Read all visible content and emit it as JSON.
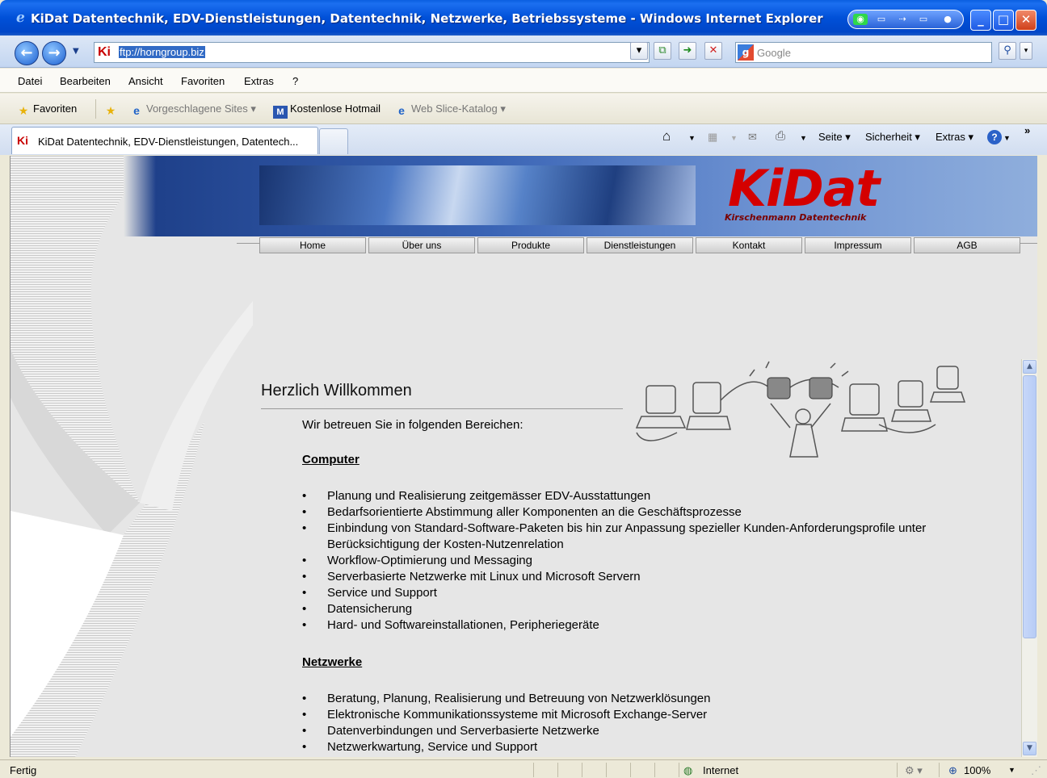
{
  "window": {
    "title": "KiDat Datentechnik, EDV-Dienstleistungen, Datentechnik, Netzwerke, Betriebssysteme - Windows Internet Explorer"
  },
  "address_bar": {
    "favicon_text": "Ki",
    "url": "ftp://horngroup.biz"
  },
  "search": {
    "placeholder": "Google",
    "engine_icon": "google-icon"
  },
  "menu": [
    "Datei",
    "Bearbeiten",
    "Ansicht",
    "Favoriten",
    "Extras",
    "?"
  ],
  "favorites_bar": {
    "favorites_label": "Favoriten",
    "items": [
      {
        "label": "Vorgeschlagene Sites ▾",
        "icon": "ie-icon"
      },
      {
        "label": "Kostenlose Hotmail",
        "icon": "hotmail-icon"
      },
      {
        "label": "Web Slice-Katalog ▾",
        "icon": "webslice-icon"
      }
    ]
  },
  "tab": {
    "favicon_text": "Ki",
    "title": "KiDat Datentechnik, EDV-Dienstleistungen, Datentech..."
  },
  "command_bar": {
    "seite": "Seite ▾",
    "sicherheit": "Sicherheit ▾",
    "extras": "Extras ▾",
    "more": "»"
  },
  "site": {
    "logo_text": "KiDat",
    "logo_tagline": "Kirschenmann Datentechnik",
    "nav": [
      "Home",
      "Über uns",
      "Produkte",
      "Dienstleistungen",
      "Kontakt",
      "Impressum",
      "AGB"
    ],
    "heading": "Herzlich Willkommen",
    "intro": "Wir betreuen Sie in folgenden Bereichen:",
    "sections": [
      {
        "title": "Computer",
        "items": [
          "Planung und Realisierung zeitgemässer EDV-Ausstattungen",
          "Bedarfsorientierte Abstimmung aller Komponenten an die Geschäftsprozesse",
          "Einbindung von Standard-Software-Paketen bis hin zur Anpassung spezieller Kunden-Anforderungsprofile unter Berücksichtigung der Kosten-Nutzenrelation",
          "Workflow-Optimierung und Messaging",
          "Serverbasierte Netzwerke mit Linux und Microsoft Servern",
          "Service und Support",
          "Datensicherung",
          "Hard- und Softwareinstallationen, Peripheriegeräte"
        ]
      },
      {
        "title": "Netzwerke",
        "items": [
          "Beratung, Planung, Realisierung und Betreuung von Netzwerklösungen",
          "Elektronische Kommunikationssysteme mit Microsoft Exchange-Server",
          "Datenverbindungen und Serverbasierte Netzwerke",
          "Netzwerkwartung, Service und Support"
        ]
      }
    ]
  },
  "status_bar": {
    "status": "Fertig",
    "zone": "Internet",
    "zoom": "100%"
  },
  "colors": {
    "titlebar": "#0050d8",
    "logo_red": "#d40000",
    "page_bg": "#e6e6e6"
  }
}
